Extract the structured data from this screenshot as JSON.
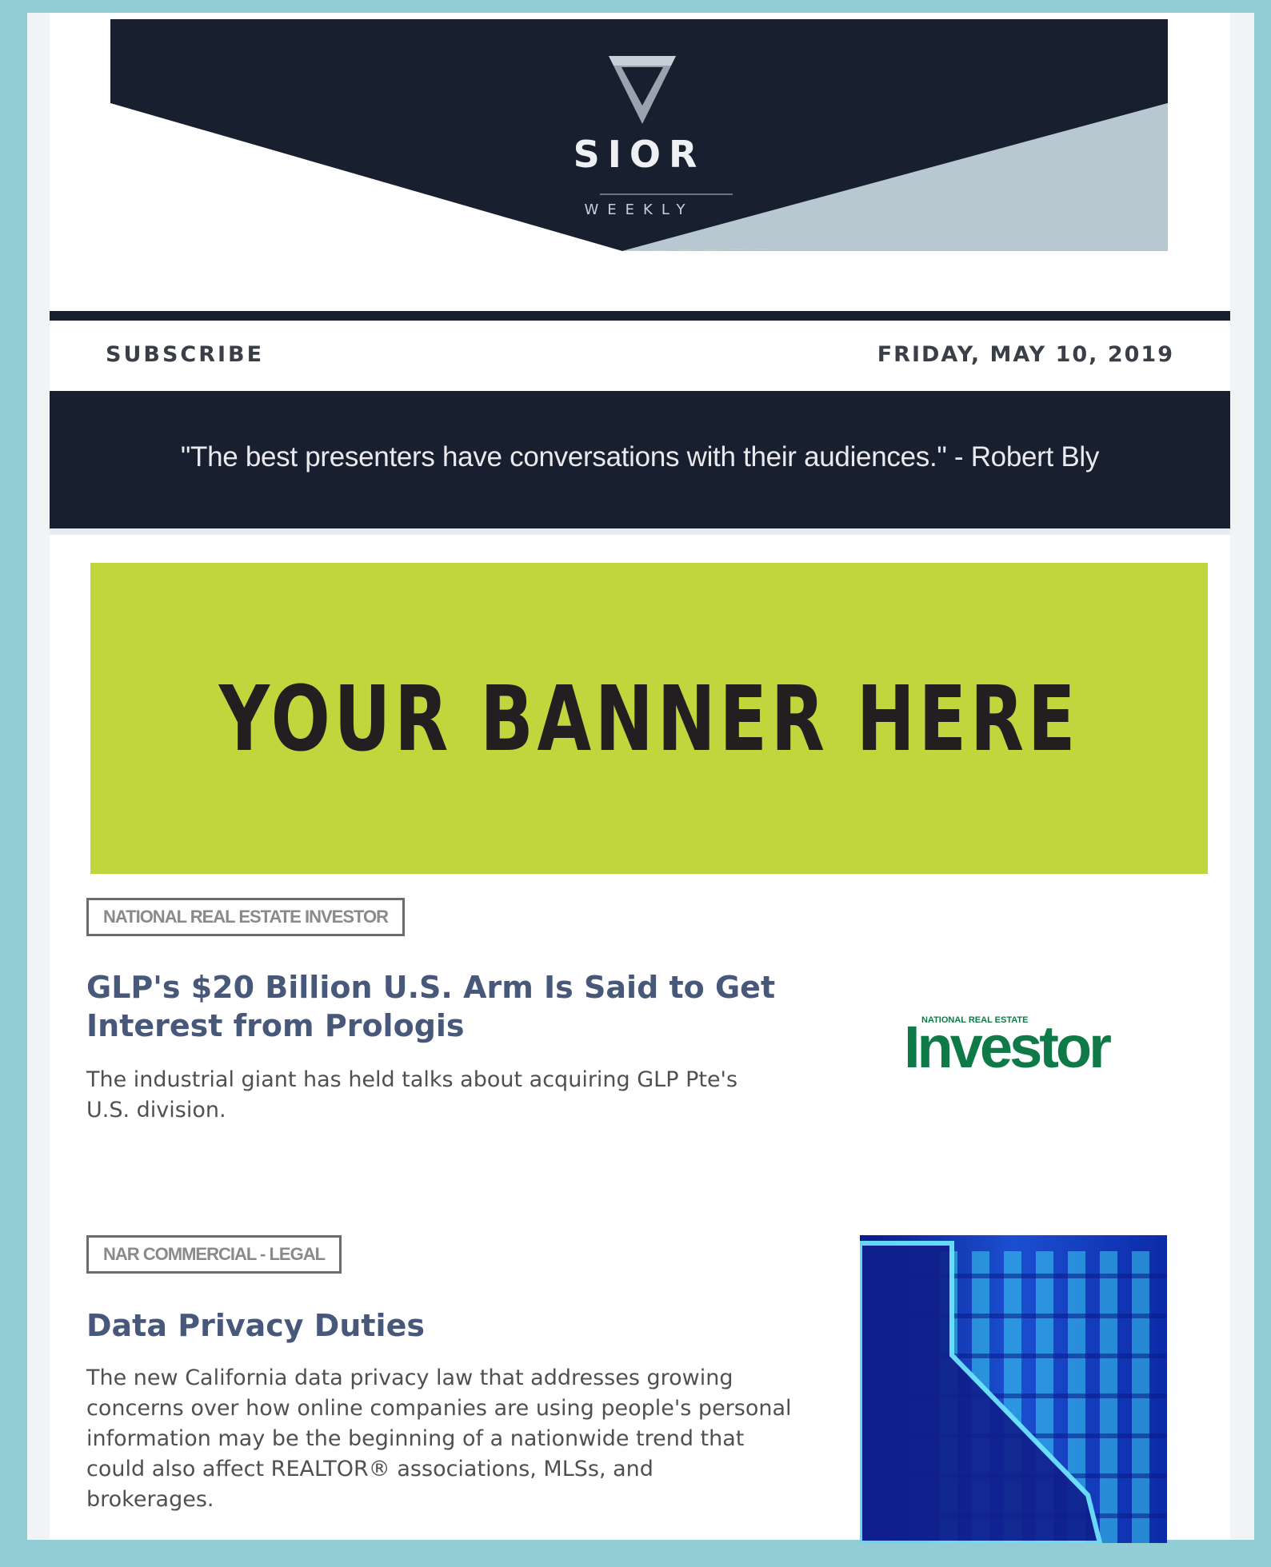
{
  "header": {
    "logo_name": "SIOR",
    "logo_sub": "WEEKLY",
    "colors": {
      "navy": "#18202f",
      "light": "#b8c8d1",
      "accent": "#c1d53d"
    }
  },
  "nav": {
    "subscribe_label": "SUBSCRIBE",
    "date": "FRIDAY, MAY 10, 2019"
  },
  "quote": "\"The best presenters have conversations with their audiences.\" - Robert Bly",
  "banner": {
    "label": "YOUR BANNER HERE"
  },
  "articles": [
    {
      "source": "NATIONAL REAL ESTATE INVESTOR",
      "title_line1": "GLP's $20 Billion U.S. Arm Is Said to Get",
      "title_line2": "Interest from Prologis",
      "summary_line1": "The industrial giant has held talks about acquiring GLP Pte's",
      "summary_line2": "U.S. division.",
      "image": {
        "icon": "investor-logo",
        "small_text": "NATIONAL REAL ESTATE",
        "big_text": "Investor"
      }
    },
    {
      "source": "NAR COMMERCIAL - LEGAL",
      "title": "Data Privacy Duties",
      "summary_lines": [
        "The new California data privacy law that addresses growing",
        "concerns over how online companies are using people's personal",
        "information may be the beginning of a nationwide trend that",
        "could also affect REALTOR® associations, MLSs, and",
        "brokerages."
      ],
      "image": {
        "icon": "california-map-image"
      }
    }
  ]
}
